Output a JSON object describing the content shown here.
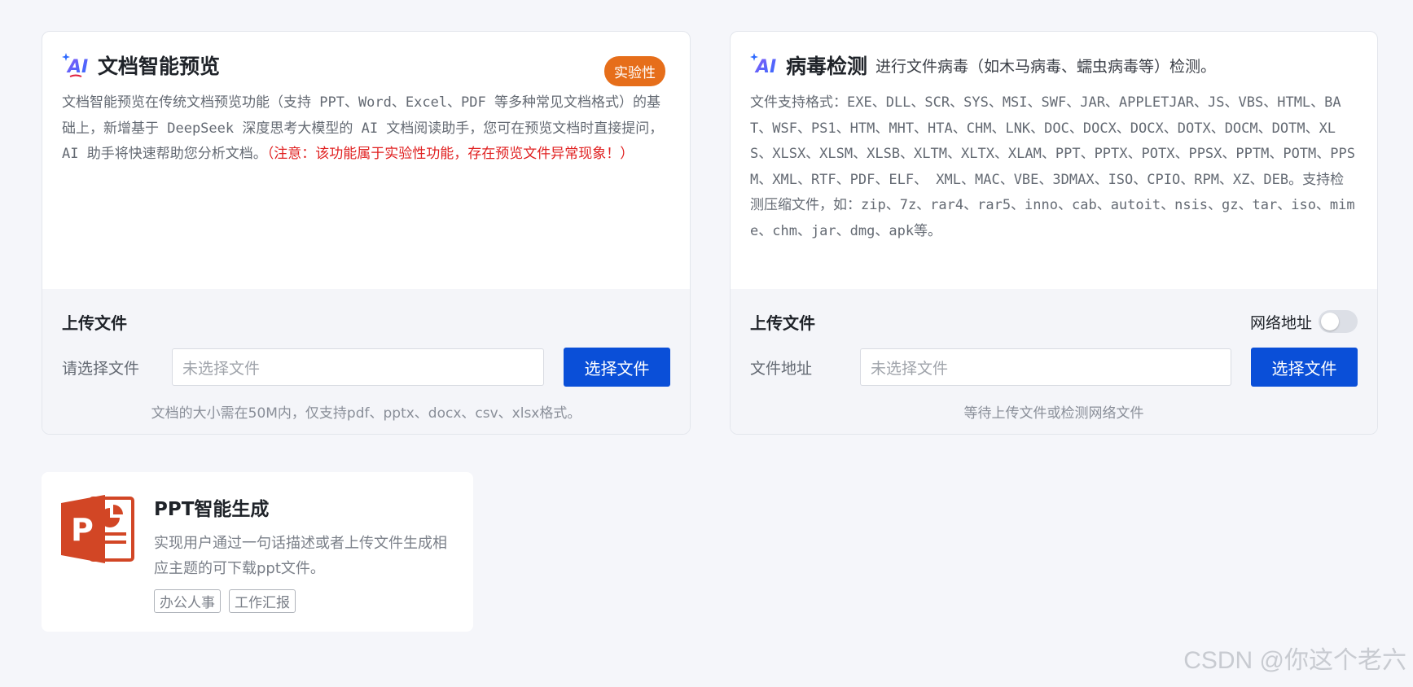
{
  "doc_card": {
    "title": "文档智能预览",
    "badge": "实验性",
    "desc": "文档智能预览在传统文档预览功能（支持 PPT、Word、Excel、PDF 等多种常见文档格式）的基础上，新增基于 DeepSeek 深度思考大模型的 AI 文档阅读助手，您可在预览文档时直接提问，AI 助手将快速帮助您分析文档。",
    "warning": "（注意：该功能属于实验性功能，存在预览文件异常现象！）",
    "upload_title": "上传文件",
    "row_label": "请选择文件",
    "input_placeholder": "未选择文件",
    "button_label": "选择文件",
    "hint": "文档的大小需在50M内，仅支持pdf、pptx、docx、csv、xlsx格式。"
  },
  "virus_card": {
    "title": "病毒检测",
    "subtitle": "进行文件病毒（如木马病毒、蠕虫病毒等）检测。",
    "desc": "文件支持格式：EXE、DLL、SCR、SYS、MSI、SWF、JAR、APPLETJAR、JS、VBS、HTML、BAT、WSF、PS1、HTM、MHT、HTA、CHM、LNK、DOC、DOCX、DOCX、DOTX、DOCM、DOTM、XLS、XLSX、XLSM、XLSB、XLTM、XLTX、XLAM、PPT、PPTX、POTX、PPSX、PPTM、POTM、PPSM、XML、RTF、PDF、ELF、 XML、MAC、VBE、3DMAX、ISO、CPIO、RPM、XZ、DEB。支持检测压缩文件，如：zip、7z、rar4、rar5、inno、cab、autoit、nsis、gz、tar、iso、mime、chm、jar、dmg、apk等。",
    "upload_title": "上传文件",
    "toggle_label": "网络地址",
    "toggle_on": false,
    "row_label": "文件地址",
    "input_placeholder": "未选择文件",
    "button_label": "选择文件",
    "hint": "等待上传文件或检测网络文件"
  },
  "ppt_card": {
    "title": "PPT智能生成",
    "desc": "实现用户通过一句话描述或者上传文件生成相应主题的可下载ppt文件。",
    "tags": [
      "办公人事",
      "工作汇报"
    ],
    "logo_letter": "P"
  },
  "watermark": "CSDN @你这个老六",
  "colors": {
    "primary_button": "#0a4fd8",
    "badge": "#e66e1a",
    "warning_text": "#e02020",
    "ppt_logo": "#d24625"
  },
  "icons": {
    "ai_icon": "ai-sparkle-icon",
    "ppt_icon": "powerpoint-icon"
  }
}
